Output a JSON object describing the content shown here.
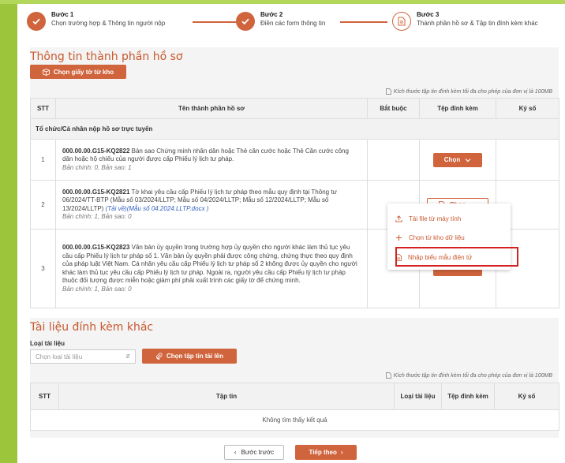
{
  "stepper": {
    "steps": [
      {
        "title": "Bước 1",
        "desc": "Chọn trường hợp & Thông tin người nộp",
        "state": "done"
      },
      {
        "title": "Bước 2",
        "desc": "Điền các form thông tin",
        "state": "done"
      },
      {
        "title": "Bước 3",
        "desc": "Thành phần hồ sơ & Tập tin đính kèm khác",
        "state": "current"
      }
    ]
  },
  "documents": {
    "title": "Thông tin thành phần hồ sơ",
    "pick_from_repo_label": "Chọn giấy tờ từ kho",
    "size_note": "Kích thước tập tin đính kèm tối đa cho phép của đơn vị là 100MB",
    "columns": [
      "STT",
      "Tên thành phần hồ sơ",
      "Bắt buộc",
      "Tệp đính kèm",
      "Ký số"
    ],
    "group_label": "Tổ chức/Cá nhân nộp hồ sơ trực tuyến",
    "rows": [
      {
        "stt": "1",
        "code": "000.00.00.G15-KQ2822",
        "text": "Bản sao Chứng minh nhân dân hoặc Thẻ căn cước hoặc Thẻ Căn cước công dân hoặc hộ chiếu của người được cấp Phiếu lý lịch tư pháp.",
        "link": "",
        "copies": "Bản chính: 0, Bản sao: 1",
        "choose_label": "Chọn"
      },
      {
        "stt": "2",
        "code": "000.00.00.G15-KQ2821",
        "text": "Tờ khai yêu cầu cấp Phiếu lý lịch tư pháp theo mẫu quy định tại Thông tư 06/2024/TT-BTP (Mẫu số 03/2024/LLTP; Mẫu số 04/2024/LLTP; Mẫu số 12/2024/LLTP; Mẫu số 13/2024/LLTP)",
        "link": "(Tải về)(Mẫu số 04.2024.LLTP.docx )",
        "copies": "Bản chính: 1, Bản sao: 0",
        "choose_label": "Chọn"
      },
      {
        "stt": "3",
        "code": "000.00.00.G15-KQ2823",
        "text": "Văn bản ủy quyền trong trường hợp ủy quyền cho người khác làm thủ tục yêu cầu cấp Phiếu lý lịch tư pháp số 1. Văn bản ủy quyền phải được công chứng, chứng thực theo quy định của pháp luật Việt Nam. Cá nhân yêu cầu cấp Phiếu lý lịch tư pháp số 2 không được ủy quyền cho người khác làm thủ tục yêu cầu cấp Phiếu lý lịch tư pháp. Ngoài ra, người yêu cầu cấp Phiếu lý lịch tư pháp thuộc đối tượng được miễn hoặc giảm phí phải xuất trình các giấy tờ để chứng minh.",
        "link": "",
        "copies": "Bản chính: 1, Bản sao: 0",
        "choose_label": ""
      }
    ]
  },
  "dropdown_menu": {
    "items": [
      {
        "label": "Tải file từ máy tính",
        "icon": "upload-icon"
      },
      {
        "label": "Chọn từ kho dữ liệu",
        "icon": "plus-icon"
      },
      {
        "label": "Nhập biểu mẫu điện tử",
        "icon": "form-document-icon",
        "highlighted": true
      }
    ]
  },
  "other_attachments": {
    "title": "Tài liệu đính kèm khác",
    "type_label": "Loại tài liệu",
    "type_placeholder": "Chọn loại tài liệu",
    "upload_label": "Chọn tập tin tải lên",
    "size_note": "Kích thước tập tin đính kèm tối đa cho phép của đơn vị là 100MB",
    "columns": [
      "STT",
      "Tập tin",
      "Loại tài liệu",
      "Tệp đính kèm",
      "Ký số"
    ],
    "empty_text": "Không tìm thấy kết quả"
  },
  "footer": {
    "back_label": "Bước trước",
    "next_label": "Tiếp theo"
  },
  "colors": {
    "accent": "#d0643d",
    "highlight_border": "#d42121",
    "frame_green": "#9cc53b"
  }
}
